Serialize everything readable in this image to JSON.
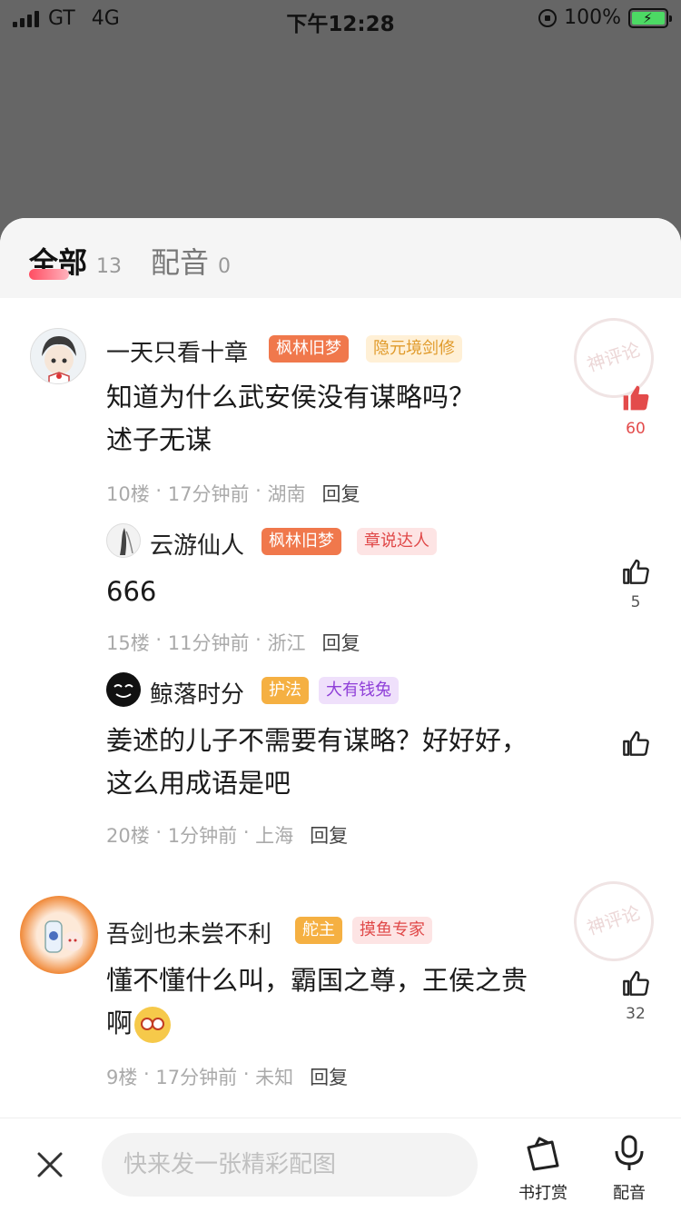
{
  "status_bar": {
    "carrier": "GT",
    "network": "4G",
    "time": "下午12:28",
    "battery": "100%"
  },
  "tabs": [
    {
      "label": "全部",
      "count": "13"
    },
    {
      "label": "配音",
      "count": "0"
    }
  ],
  "stamp_text": "神评论",
  "comments": [
    {
      "username": "一天只看十章",
      "badges": [
        "枫林旧梦",
        "隐元境剑修"
      ],
      "lines": [
        "知道为什么武安侯没有谋略吗？",
        "述子无谋"
      ],
      "floor": "10楼",
      "time": "17分钟前",
      "location": "湖南",
      "reply_label": "回复",
      "likes": "60"
    },
    {
      "username": "云游仙人",
      "badges": [
        "枫林旧梦",
        "章说达人"
      ],
      "lines": [
        "666"
      ],
      "floor": "15楼",
      "time": "11分钟前",
      "location": "浙江",
      "reply_label": "回复",
      "likes": "5"
    },
    {
      "username": "鲸落时分",
      "badges": [
        "护法",
        "大有钱兔"
      ],
      "lines": [
        "姜述的儿子不需要有谋略？好好好，",
        "这么用成语是吧"
      ],
      "floor": "20楼",
      "time": "1分钟前",
      "location": "上海",
      "reply_label": "回复",
      "likes": ""
    },
    {
      "username": "吾剑也未尝不利",
      "badges": [
        "舵主",
        "摸鱼专家"
      ],
      "lines": [
        "懂不懂什么叫，霸国之尊，王侯之贵",
        "啊"
      ],
      "floor": "9楼",
      "time": "17分钟前",
      "location": "未知",
      "reply_label": "回复",
      "likes": "32"
    }
  ],
  "bottom": {
    "input_placeholder": "快来发一张精彩配图",
    "reward_label": "书打赏",
    "dub_label": "配音"
  },
  "colors": {
    "accent_red": "#e34b4b",
    "badge_orange": "#f0784c"
  }
}
